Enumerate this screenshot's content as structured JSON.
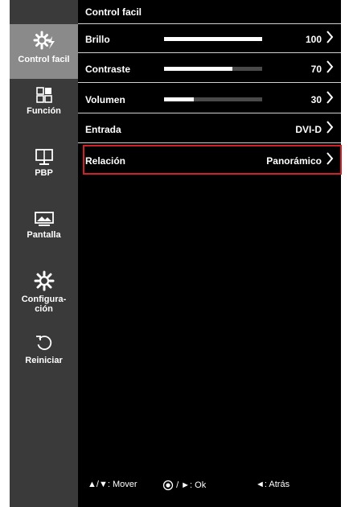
{
  "sidebar": {
    "items": [
      {
        "label": "Control facil",
        "active": true
      },
      {
        "label": "Función"
      },
      {
        "label": "PBP"
      },
      {
        "label": "Pantalla"
      },
      {
        "label_lines": [
          "Configura-",
          "ción"
        ]
      },
      {
        "label": "Reiniciar"
      }
    ]
  },
  "header": {
    "title": "Control facil"
  },
  "rows": [
    {
      "label": "Brillo",
      "value": "100",
      "level": 100
    },
    {
      "label": "Contraste",
      "value": "70",
      "level": 70
    },
    {
      "label": "Volumen",
      "value": "30",
      "level": 30
    },
    {
      "label": "Entrada",
      "value": "DVI-D"
    },
    {
      "label": "Relación",
      "value": "Panorámico",
      "selected": true
    }
  ],
  "footer": {
    "move": "▲/▼: Mover",
    "ok": "/ ►: Ok",
    "back": "◄: Atrás"
  },
  "colors": {
    "selection": "#d0202a",
    "sidebar": "#3a3a3a",
    "active": "#8a8a8a"
  }
}
